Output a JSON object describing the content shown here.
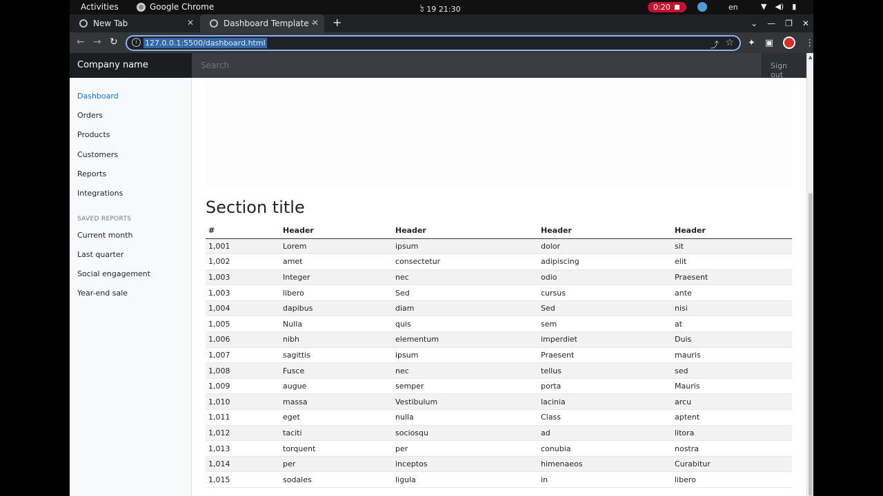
{
  "topbar": {
    "activities": "Activities",
    "app_name": "Google Chrome",
    "clock": "ঠ 19  21:30",
    "recording": "0:20",
    "lang": "en"
  },
  "browser": {
    "tabs": [
      {
        "label": "New Tab"
      },
      {
        "label": "Dashboard Template · Bo"
      }
    ],
    "url": "127.0.0.1:5500/dashboard.html"
  },
  "navbar": {
    "brand": "Company name",
    "search_placeholder": "Search",
    "sign_out": "Sign out"
  },
  "sidebar": {
    "items": [
      {
        "label": "Dashboard"
      },
      {
        "label": "Orders"
      },
      {
        "label": "Products"
      },
      {
        "label": "Customers"
      },
      {
        "label": "Reports"
      },
      {
        "label": "Integrations"
      }
    ],
    "saved_heading": "SAVED REPORTS",
    "saved": [
      {
        "label": "Current month"
      },
      {
        "label": "Last quarter"
      },
      {
        "label": "Social engagement"
      },
      {
        "label": "Year-end sale"
      }
    ]
  },
  "main": {
    "section_title": "Section title",
    "table": {
      "headers": [
        "#",
        "Header",
        "Header",
        "Header",
        "Header"
      ],
      "rows": [
        [
          "1,001",
          "Lorem",
          "ipsum",
          "dolor",
          "sit"
        ],
        [
          "1,002",
          "amet",
          "consectetur",
          "adipiscing",
          "elit"
        ],
        [
          "1,003",
          "Integer",
          "nec",
          "odio",
          "Praesent"
        ],
        [
          "1,003",
          "libero",
          "Sed",
          "cursus",
          "ante"
        ],
        [
          "1,004",
          "dapibus",
          "diam",
          "Sed",
          "nisi"
        ],
        [
          "1,005",
          "Nulla",
          "quis",
          "sem",
          "at"
        ],
        [
          "1,006",
          "nibh",
          "elementum",
          "imperdiet",
          "Duis"
        ],
        [
          "1,007",
          "sagittis",
          "ipsum",
          "Praesent",
          "mauris"
        ],
        [
          "1,008",
          "Fusce",
          "nec",
          "tellus",
          "sed"
        ],
        [
          "1,009",
          "augue",
          "semper",
          "porta",
          "Mauris"
        ],
        [
          "1,010",
          "massa",
          "Vestibulum",
          "lacinia",
          "arcu"
        ],
        [
          "1,011",
          "eget",
          "nulla",
          "Class",
          "aptent"
        ],
        [
          "1,012",
          "taciti",
          "sociosqu",
          "ad",
          "litora"
        ],
        [
          "1,013",
          "torquent",
          "per",
          "conubia",
          "nostra"
        ],
        [
          "1,014",
          "per",
          "inceptos",
          "himenaeos",
          "Curabitur"
        ],
        [
          "1,015",
          "sodales",
          "ligula",
          "in",
          "libero"
        ]
      ]
    }
  }
}
